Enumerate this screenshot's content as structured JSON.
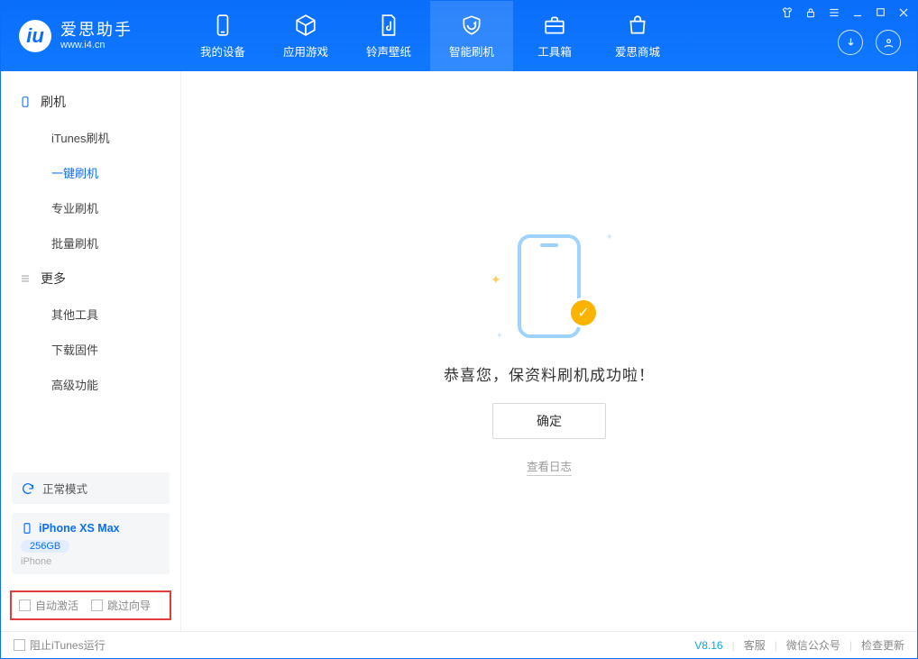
{
  "app": {
    "name_cn": "爱思助手",
    "name_en": "www.i4.cn"
  },
  "nav": {
    "my_device": "我的设备",
    "apps": "应用游戏",
    "ringtones": "铃声壁纸",
    "smart_flash": "智能刷机",
    "toolbox": "工具箱",
    "store": "爱思商城"
  },
  "sidebar": {
    "group_flash": "刷机",
    "items_flash": [
      "iTunes刷机",
      "一键刷机",
      "专业刷机",
      "批量刷机"
    ],
    "group_more": "更多",
    "items_more": [
      "其他工具",
      "下载固件",
      "高级功能"
    ],
    "mode_label": "正常模式",
    "device_name": "iPhone XS Max",
    "device_capacity": "256GB",
    "device_type": "iPhone",
    "opt_auto_activate": "自动激活",
    "opt_skip_guide": "跳过向导"
  },
  "main": {
    "success_msg": "恭喜您，保资料刷机成功啦！",
    "ok_label": "确定",
    "view_log": "查看日志"
  },
  "status": {
    "block_itunes": "阻止iTunes运行",
    "version": "V8.16",
    "support": "客服",
    "wechat": "微信公众号",
    "check_update": "检查更新"
  },
  "colors": {
    "primary": "#0a6efa",
    "accent": "#fab400"
  }
}
